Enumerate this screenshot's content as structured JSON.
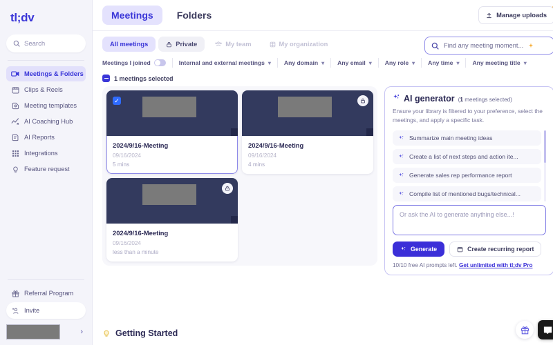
{
  "sidebar": {
    "logo": "tl;dv",
    "search_label": "Search",
    "items": [
      {
        "label": "Meetings & Folders",
        "icon": "video-camera-icon"
      },
      {
        "label": "Clips & Reels",
        "icon": "clips-icon"
      },
      {
        "label": "Meeting templates",
        "icon": "template-icon"
      },
      {
        "label": "AI Coaching Hub",
        "icon": "coaching-icon"
      },
      {
        "label": "AI Reports",
        "icon": "report-icon"
      },
      {
        "label": "Integrations",
        "icon": "grid-icon"
      },
      {
        "label": "Feature request",
        "icon": "lightbulb-icon"
      }
    ],
    "referral_label": "Referral Program",
    "invite_label": "Invite"
  },
  "header": {
    "tabs": [
      {
        "label": "Meetings",
        "active": true
      },
      {
        "label": "Folders",
        "active": false
      }
    ],
    "manage_uploads": "Manage uploads"
  },
  "filters": {
    "segments": [
      {
        "label": "All meetings",
        "state": "active"
      },
      {
        "label": "Private",
        "state": "plain",
        "icon": "lock-icon"
      },
      {
        "label": "My team",
        "state": "disabled",
        "icon": "people-icon"
      },
      {
        "label": "My organization",
        "state": "disabled",
        "icon": "building-icon"
      }
    ],
    "toggle_label": "Meetings I joined",
    "toggle_on": false,
    "dropdowns": [
      "Internal and external meetings",
      "Any domain",
      "Any email",
      "Any role",
      "Any time",
      "Any meeting title"
    ]
  },
  "search": {
    "placeholder": "Find any meeting moment...",
    "icon": "search-icon"
  },
  "selection": {
    "text": "1 meetings selected"
  },
  "meetings": [
    {
      "title": "2024/9/16-Meeting",
      "date": "09/16/2024",
      "duration": "5 mins",
      "selected": true,
      "locked": false
    },
    {
      "title": "2024/9/16-Meeting",
      "date": "09/16/2024",
      "duration": "4 mins",
      "selected": false,
      "locked": true
    },
    {
      "title": "2024/9/16-Meeting",
      "date": "09/16/2024",
      "duration": "less than a minute",
      "selected": false,
      "locked": true
    }
  ],
  "ai_panel": {
    "title": "AI generator",
    "count_prefix": "1",
    "count_suffix": " meetings selected)",
    "subtitle": "Ensure your library is filtered to your preference, select the meetings, and apply a specific task.",
    "prompts": [
      "Summarize main meeting ideas",
      "Create a list of next steps and action ite...",
      "Generate sales rep performance report",
      "Compile list of mentioned bugs/technical..."
    ],
    "textarea_placeholder": "Or ask the AI to generate anything else...!",
    "generate_label": "Generate",
    "recurring_label": "Create recurring report",
    "quota_text": "10/10 free AI prompts left.",
    "upgrade_link": "Get unlimited with tl;dv Pro"
  },
  "footer": {
    "getting_started": "Getting Started"
  },
  "colors": {
    "accent": "#3b37d8",
    "accent_soft": "#e4e2fd",
    "thumb_dark": "#333a5e",
    "checkbox_blue": "#2f6bff",
    "notification_dot": "#f5a623"
  }
}
